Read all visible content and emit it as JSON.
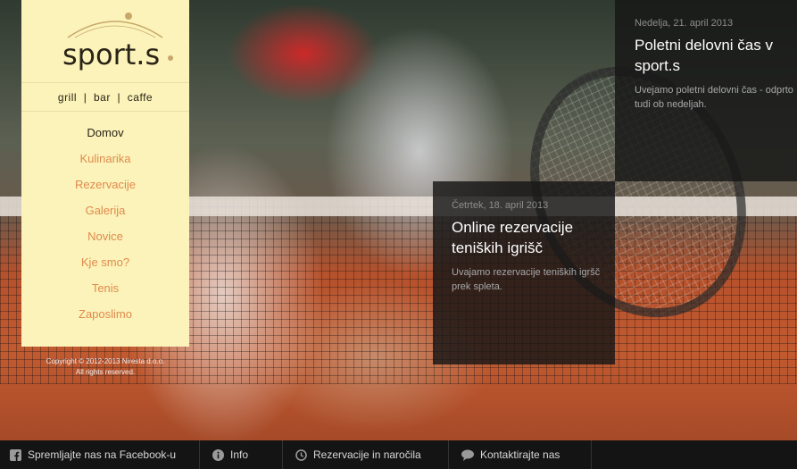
{
  "logo": {
    "name": "sport.s"
  },
  "tagline": "grill  |  bar  |  caffe",
  "nav": [
    {
      "label": "Domov",
      "active": true
    },
    {
      "label": "Kulinarika"
    },
    {
      "label": "Rezervacije"
    },
    {
      "label": "Galerija"
    },
    {
      "label": "Novice"
    },
    {
      "label": "Kje smo?"
    },
    {
      "label": "Tenis"
    },
    {
      "label": "Zaposlimo"
    }
  ],
  "copyright": {
    "line1": "Copyright © 2012-2013 Niresta d.o.o.",
    "line2": "All rights reserved."
  },
  "news": [
    {
      "date": "Nedelja, 21. april 2013",
      "title": "Poletni delovni čas v sport.s",
      "text": "Uvejamo poletni delovni čas - odprto tudi ob nedeljah."
    },
    {
      "date": "Četrtek, 18. april 2013",
      "title": "Online rezervacije teniških igrišč",
      "text": "Uvajamo rezervacije teniških igršč prek spleta."
    }
  ],
  "footer": {
    "facebook": "Spremljajte nas na Facebook-u",
    "info": "Info",
    "reservations": "Rezervacije in naročila",
    "contact": "Kontaktirajte nas"
  },
  "colors": {
    "sidebar_bg": "#fbf3b9",
    "nav_link": "#e08a4e",
    "nav_active": "#2a2317",
    "panel_bg": "#161616",
    "footer_bg": "#141414"
  },
  "icons": {
    "facebook": "facebook-icon",
    "info": "info-icon",
    "reservations": "clock-icon",
    "contact": "speech-bubble-icon"
  }
}
